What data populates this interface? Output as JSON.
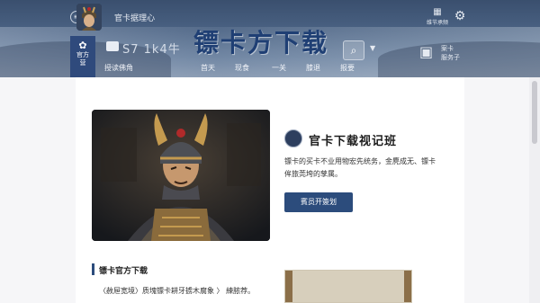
{
  "header": {
    "site_name": "官卡据理心",
    "banner_title": "镖卡方下载",
    "store_stats": "S7  1k4牛",
    "home_label": "官方\n营",
    "right_util_label": "维节承频",
    "region_label": "案卡\n服务子",
    "colors": {
      "header_top": "#3a4f6e",
      "banner_text": "#1f3f74",
      "nav_active_bg": "#2f4a7c"
    }
  },
  "nav": {
    "items": [
      "授读佛角",
      "首天",
      "现食",
      "一关",
      "膝退",
      "报要"
    ]
  },
  "icons": {
    "menu": "menu-circle-icon",
    "avatar": "warrior-avatar-icon",
    "util": "calendar-icon",
    "settings": "gear-icon",
    "home": "home-icon",
    "store": "store-icon",
    "search": "search-icon",
    "dropdown": "chevron-down-icon",
    "region": "building-icon"
  },
  "feature": {
    "title": "官卡下载视记班",
    "description": "镖卡的买卡不业用物宏先统务，金麂成无、镖卡侔旅莞垮的孳属。",
    "cta_label": "賓员开簽划",
    "colors": {
      "cta_bg": "#2c4c7c"
    }
  },
  "section": {
    "title": "镖卡官方下载",
    "body": "〈赦屉宽境〉质塊镖卡耕牙掳木腐象 〉 練脓荐。"
  }
}
